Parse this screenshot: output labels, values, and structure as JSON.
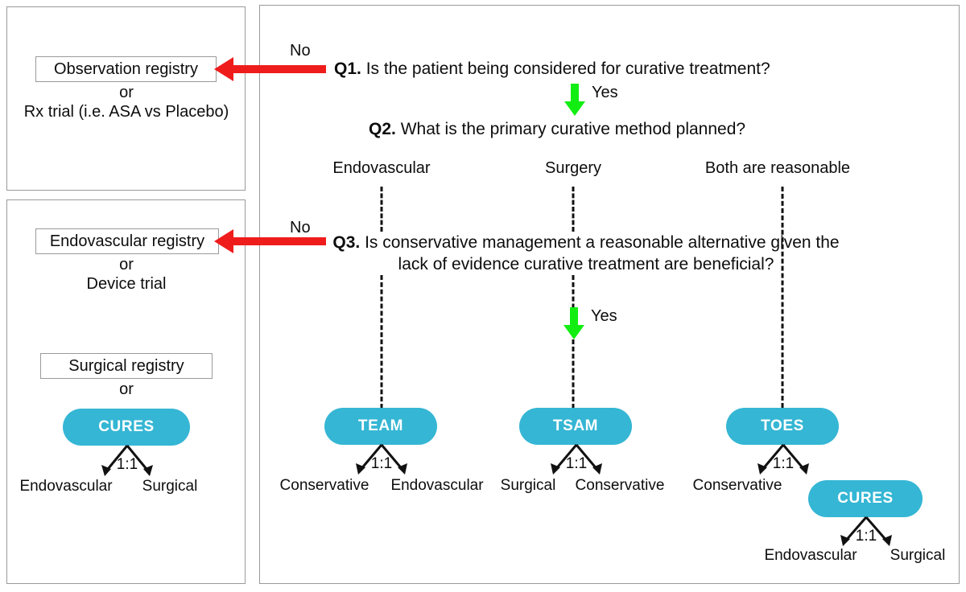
{
  "colors": {
    "teal": "#35b6d4",
    "red": "#ef1c1c",
    "green": "#12ee12",
    "border": "#9a9a9a",
    "text": "#0d0d0d"
  },
  "left_panel_top": {
    "box_label": "Observation registry",
    "or_label": "or",
    "alternative": "Rx trial (i.e. ASA vs Placebo)"
  },
  "left_panel_bottom": {
    "endovascular_box": "Endovascular registry",
    "or_label_1": "or",
    "device_trial": "Device trial",
    "surgical_box": "Surgical registry",
    "or_label_2": "or",
    "cures_pill": "CURES",
    "ratio": "1:1",
    "branch_left": "Endovascular",
    "branch_right": "Surgical"
  },
  "decision": {
    "q1": {
      "tag": "Q1.",
      "text": "Is the patient being considered for curative treatment?"
    },
    "q1_no": "No",
    "q1_yes": "Yes",
    "q2": {
      "tag": "Q2.",
      "text": "What is the primary curative method planned?"
    },
    "q2_options": [
      "Endovascular",
      "Surgery",
      "Both are reasonable"
    ],
    "q3": {
      "tag": "Q3.",
      "line1": "Is conservative management a reasonable alternative",
      "line2": "given the lack of evidence curative treatment are beneficial?"
    },
    "q3_no": "No",
    "q3_yes": "Yes",
    "trials": [
      {
        "name": "TEAM",
        "ratio": "1:1",
        "arm_left": "Conservative",
        "arm_right": "Endovascular"
      },
      {
        "name": "TSAM",
        "ratio": "1:1",
        "arm_left": "Surgical",
        "arm_right": "Conservative"
      },
      {
        "name": "TOES",
        "ratio": "1:1",
        "arm_left": "Conservative",
        "arm_right": "CURES"
      }
    ],
    "cures": {
      "name": "CURES",
      "ratio": "1:1",
      "arm_left": "Endovascular",
      "arm_right": "Surgical"
    }
  }
}
